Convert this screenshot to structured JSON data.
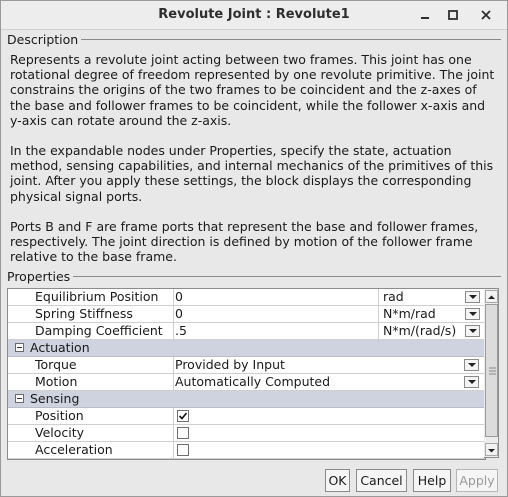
{
  "window": {
    "title": "Revolute Joint : Revolute1",
    "minimize_icon": "minimize-icon",
    "maximize_icon": "maximize-icon",
    "close_icon": "close-icon"
  },
  "description": {
    "label": "Description",
    "paragraphs": [
      "Represents a revolute joint acting between two frames. This joint has one rotational degree of freedom represented by one revolute primitive. The joint constrains the origins of the two frames to be coincident and the z-axes of the base and follower frames to be coincident, while the follower x-axis and y-axis can rotate around the z-axis.",
      "In the expandable nodes under Properties, specify the state, actuation method, sensing capabilities, and internal mechanics of the primitives of this joint. After you apply these settings, the block displays the corresponding physical signal ports.",
      "Ports B and F are frame ports that represent the base and follower frames, respectively. The joint direction is defined by motion of the follower frame relative to the base frame."
    ]
  },
  "properties": {
    "label": "Properties",
    "rows": [
      {
        "name": "Equilibrium Position",
        "value": "0",
        "unit": "rad"
      },
      {
        "name": "Spring Stiffness",
        "value": "0",
        "unit": "N*m/rad"
      },
      {
        "name": "Damping Coefficient",
        "value": ".5",
        "unit": "N*m/(rad/s)"
      }
    ],
    "actuation": {
      "label": "Actuation",
      "torque": {
        "name": "Torque",
        "value": "Provided by Input"
      },
      "motion": {
        "name": "Motion",
        "value": "Automatically Computed"
      }
    },
    "sensing": {
      "label": "Sensing",
      "items": [
        {
          "name": "Position",
          "checked": true
        },
        {
          "name": "Velocity",
          "checked": false
        },
        {
          "name": "Acceleration",
          "checked": false
        }
      ]
    }
  },
  "buttons": {
    "ok": "OK",
    "cancel": "Cancel",
    "help": "Help",
    "apply": "Apply"
  }
}
